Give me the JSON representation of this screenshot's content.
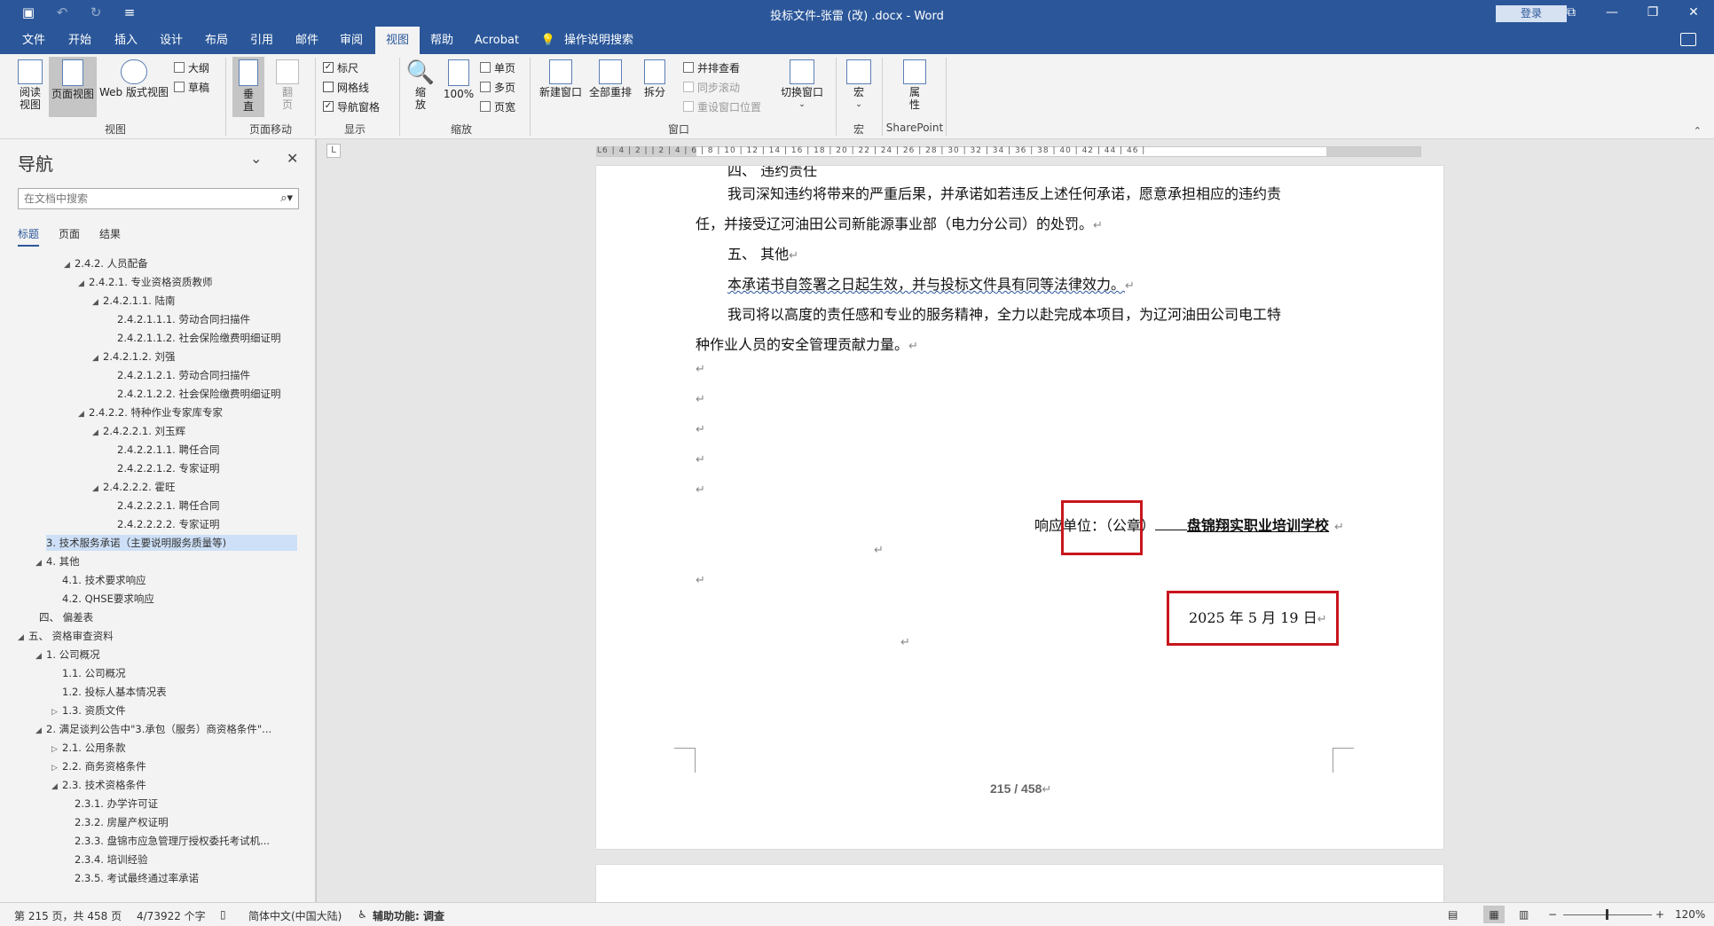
{
  "titlebar": {
    "title": "投标文件-张雷 (改) .docx - Word",
    "login": "登录",
    "minimize": "—",
    "restore": "❐",
    "close": "✕",
    "ribbon_display": "⧉"
  },
  "menu": {
    "tabs": [
      "文件",
      "开始",
      "插入",
      "设计",
      "布局",
      "引用",
      "邮件",
      "审阅",
      "视图",
      "帮助",
      "Acrobat",
      "操作说明搜索"
    ],
    "active": "视图"
  },
  "ribbon": {
    "views": {
      "read_mode": "阅读\n视图",
      "print_layout": "页面视图",
      "web_layout": "Web 版式视图",
      "outline": "大纲",
      "draft": "草稿",
      "group": "视图"
    },
    "page_movement": {
      "vertical": "垂\n直",
      "side_to_side": "翻\n页",
      "group": "页面移动"
    },
    "show": {
      "ruler": "标尺",
      "gridlines": "网格线",
      "nav_pane": "导航窗格",
      "group": "显示"
    },
    "zoom": {
      "zoom": "缩\n放",
      "hundred": "100%",
      "one_page": "单页",
      "multi_page": "多页",
      "page_width": "页宽",
      "group": "缩放"
    },
    "window": {
      "new_window": "新建窗口",
      "arrange_all": "全部重排",
      "split": "拆分",
      "side_by_side": "并排查看",
      "sync_scroll": "同步滚动",
      "reset_position": "重设窗口位置",
      "switch_windows": "切换窗口",
      "group": "窗口"
    },
    "macros": {
      "macros": "宏",
      "group": "宏"
    },
    "sharepoint": {
      "properties": "属\n性",
      "group": "SharePoint"
    }
  },
  "nav": {
    "title": "导航",
    "search_placeholder": "在文档中搜索",
    "tabs": [
      "标题",
      "页面",
      "结果"
    ],
    "active_tab": "标题",
    "items": [
      {
        "text": "2.4.2. 人员配备",
        "level": 4,
        "exp": "◢"
      },
      {
        "text": "2.4.2.1. 专业资格资质教师",
        "level": 5,
        "exp": "◢"
      },
      {
        "text": "2.4.2.1.1. 陆南",
        "level": 6,
        "exp": "◢"
      },
      {
        "text": "2.4.2.1.1.1. 劳动合同扫描件",
        "level": 7,
        "exp": ""
      },
      {
        "text": "2.4.2.1.1.2. 社会保险缴费明细证明",
        "level": 7,
        "exp": ""
      },
      {
        "text": "2.4.2.1.2. 刘强",
        "level": 6,
        "exp": "◢"
      },
      {
        "text": "2.4.2.1.2.1. 劳动合同扫描件",
        "level": 7,
        "exp": ""
      },
      {
        "text": "2.4.2.1.2.2. 社会保险缴费明细证明",
        "level": 7,
        "exp": ""
      },
      {
        "text": "2.4.2.2. 特种作业专家库专家",
        "level": 5,
        "exp": "◢"
      },
      {
        "text": "2.4.2.2.1. 刘玉辉",
        "level": 6,
        "exp": "◢"
      },
      {
        "text": "2.4.2.2.1.1. 聘任合同",
        "level": 7,
        "exp": ""
      },
      {
        "text": "2.4.2.2.1.2. 专家证明",
        "level": 7,
        "exp": ""
      },
      {
        "text": "2.4.2.2.2. 霍旺",
        "level": 6,
        "exp": "◢"
      },
      {
        "text": "2.4.2.2.2.1. 聘任合同",
        "level": 7,
        "exp": ""
      },
      {
        "text": "2.4.2.2.2.2. 专家证明",
        "level": 7,
        "exp": ""
      },
      {
        "text": "3. 技术服务承诺（主要说明服务质量等)",
        "level": 2,
        "exp": "",
        "selected": true
      },
      {
        "text": "4. 其他",
        "level": 2,
        "exp": "◢"
      },
      {
        "text": "4.1. 技术要求响应",
        "level": 3,
        "exp": ""
      },
      {
        "text": "4.2. QHSE要求响应",
        "level": 3,
        "exp": ""
      },
      {
        "text": "四、 偏差表",
        "level": 1,
        "exp": ""
      },
      {
        "text": "五、 资格审查资料",
        "level": 0,
        "exp": "◢"
      },
      {
        "text": "1. 公司概况",
        "level": 2,
        "exp": "◢"
      },
      {
        "text": "1.1. 公司概况",
        "level": 3,
        "exp": ""
      },
      {
        "text": "1.2. 投标人基本情况表",
        "level": 3,
        "exp": ""
      },
      {
        "text": "1.3. 资质文件",
        "level": 3,
        "exp": "▷"
      },
      {
        "text": "2. 满足谈判公告中\"3.承包（服务）商资格条件\"...",
        "level": 2,
        "exp": "◢"
      },
      {
        "text": "2.1. 公用条款",
        "level": 3,
        "exp": "▷"
      },
      {
        "text": "2.2. 商务资格条件",
        "level": 3,
        "exp": "▷"
      },
      {
        "text": "2.3. 技术资格条件",
        "level": 3,
        "exp": "◢"
      },
      {
        "text": "2.3.1. 办学许可证",
        "level": 4,
        "exp": ""
      },
      {
        "text": "2.3.2. 房屋产权证明",
        "level": 4,
        "exp": ""
      },
      {
        "text": "2.3.3. 盘锦市应急管理厅授权委托考试机...",
        "level": 4,
        "exp": ""
      },
      {
        "text": "2.3.4. 培训经验",
        "level": 4,
        "exp": ""
      },
      {
        "text": "2.3.5. 考试最终通过率承诺",
        "level": 4,
        "exp": ""
      }
    ]
  },
  "ruler": {
    "numbers": "L6 | 4 | 2 |  | 2 | 4 | 6 | 8 | 10 | 12 | 14 | 16 | 18 | 20 | 22 | 24 | 26 | 28 | 30 | 32 | 34 | 36 | 38 | 40 | 42 | 44 | 46 |",
    "tab_selector": "L"
  },
  "document": {
    "cut_line": "四、 违约责任",
    "line1": "我司深知违约将带来的严重后果，并承诺如若违反上述任何承诺，愿意承担相应的违约责",
    "line2": "任，并接受辽河油田公司新能源事业部（电力分公司）的处罚。",
    "heading5": "五、 其他",
    "line3": "本承诺书自签署之日起生效，并与投标文件具有同等法律效力。",
    "line4": "我司将以高度的责任感和专业的服务精神，全力以赴完成本项目，为辽河油田公司电工特",
    "line5": "种作业人员的安全管理贡献力量。",
    "sign_label": "响应单位：",
    "seal": "（公章）",
    "company": "盘锦翔实职业培训学校",
    "date": "2025  年  5  月  19 日",
    "page_number": "215 / 458",
    "para_mark": "↵"
  },
  "status": {
    "page": "第 215 页，共 458 页",
    "words": "4/73922 个字",
    "proof_icon": "proof-icon",
    "language": "简体中文(中国大陆)",
    "accessibility": "辅助功能: 调查",
    "zoom_minus": "−",
    "zoom_plus": "+",
    "zoom": "120%"
  }
}
